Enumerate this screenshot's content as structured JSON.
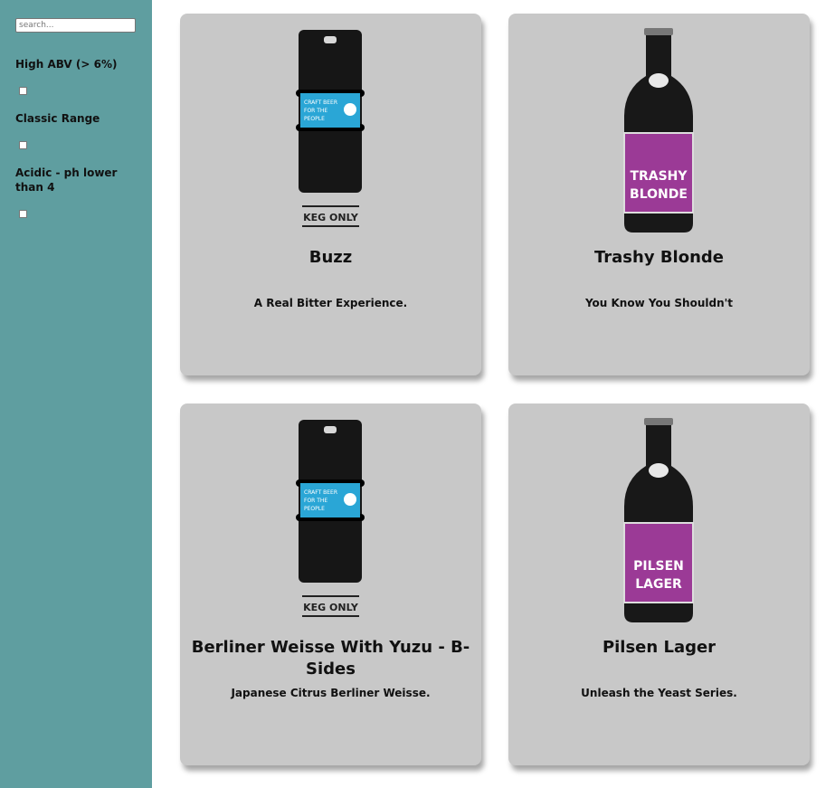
{
  "search": {
    "placeholder": "search..."
  },
  "filters": [
    {
      "label": "High ABV (> 6%)",
      "checked": false
    },
    {
      "label": "Classic Range",
      "checked": false
    },
    {
      "label": "Acidic - ph lower than 4",
      "checked": false
    }
  ],
  "beers": [
    {
      "name": "Buzz",
      "tagline": "A Real Bitter Experience.",
      "image": "keg",
      "label_text": [
        "CRAFT BEER",
        "FOR THE",
        "PEOPLE"
      ],
      "footer": "KEG ONLY"
    },
    {
      "name": "Trashy Blonde",
      "tagline": "You Know You Shouldn't",
      "image": "bottle",
      "label_text": [
        "TRASHY",
        "BLONDE"
      ]
    },
    {
      "name": "Berliner Weisse With Yuzu - B-Sides",
      "tagline": "Japanese Citrus Berliner Weisse.",
      "image": "keg",
      "label_text": [
        "CRAFT BEER",
        "FOR THE",
        "PEOPLE"
      ],
      "footer": "KEG ONLY"
    },
    {
      "name": "Pilsen Lager",
      "tagline": "Unleash the Yeast Series.",
      "image": "bottle",
      "label_text": [
        "PILSEN",
        "LAGER"
      ]
    }
  ],
  "colors": {
    "sidebar": "#5f9ea0",
    "card": "#c8c8c8",
    "keg_label": "#2aa6d6",
    "bottle_label": "#9b3a96"
  }
}
